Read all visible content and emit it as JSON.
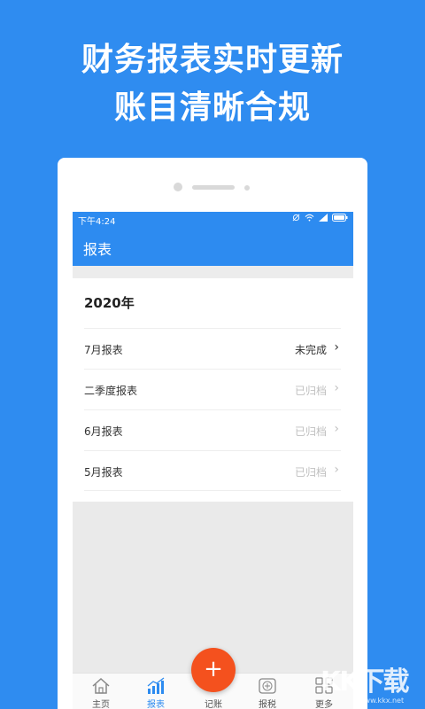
{
  "promo": {
    "line1": "财务报表实时更新",
    "line2": "账目清晰合规"
  },
  "status_bar": {
    "time": "下午4:24"
  },
  "app_bar": {
    "title": "报表"
  },
  "report_list": {
    "year": "2020年",
    "rows": [
      {
        "label": "7月报表",
        "status": "未完成",
        "state": "done"
      },
      {
        "label": "二季度报表",
        "status": "已归档",
        "state": "archived"
      },
      {
        "label": "6月报表",
        "status": "已归档",
        "state": "archived"
      },
      {
        "label": "5月报表",
        "status": "已归档",
        "state": "archived"
      }
    ]
  },
  "bottom_nav": {
    "home": "主页",
    "reports": "报表",
    "add": "记账",
    "add_symbol": "+",
    "tax": "报税",
    "more": "更多"
  },
  "colors": {
    "brand_blue": "#2f8cf0",
    "fab_orange": "#f4511e"
  },
  "watermark": {
    "text": "KK下载",
    "url": "www.kkx.net"
  }
}
